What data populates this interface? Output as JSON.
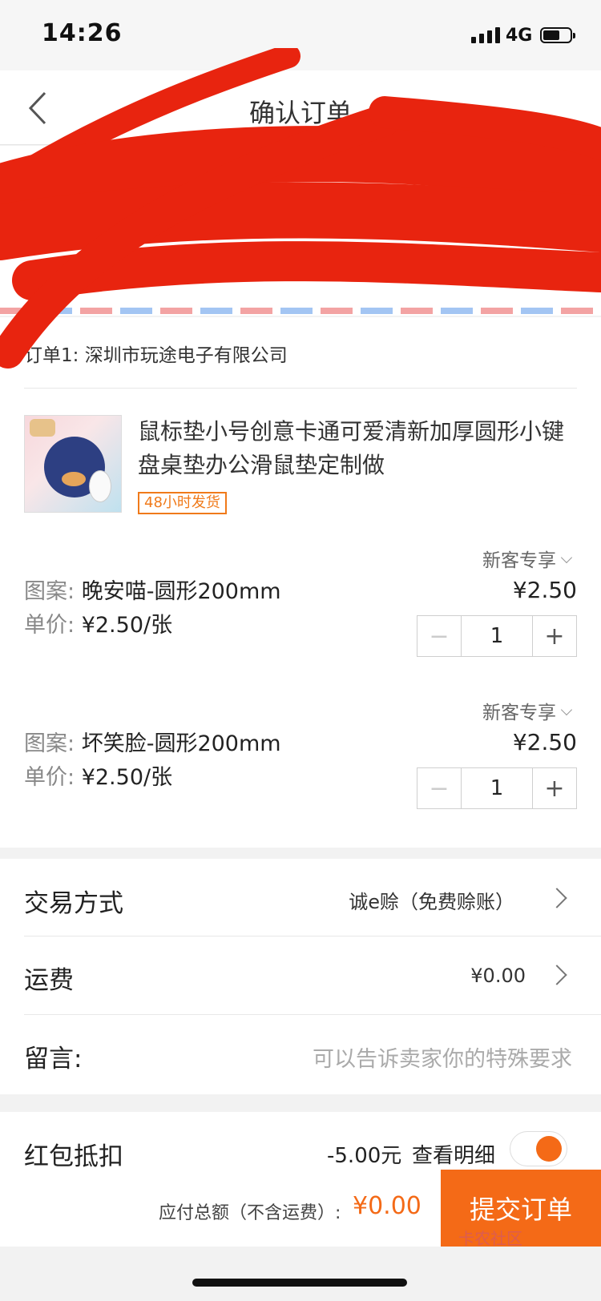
{
  "status_bar": {
    "time": "14:26",
    "network": "4G"
  },
  "nav": {
    "title": "确认订单"
  },
  "order": {
    "shop_label": "订单1: 深圳市玩途电子有限公司",
    "product": {
      "title": "鼠标垫小号创意卡通可爱清新加厚圆形小键盘桌垫办公滑鼠垫定制做",
      "tag": "48小时发货"
    },
    "items": [
      {
        "promo": "新客专享",
        "spec_key": "图案:",
        "spec_value": "晚安喵-圆形200mm",
        "unit_key": "单价:",
        "unit_value": "¥2.50/张",
        "price": "¥2.50",
        "qty": "1",
        "minus": "−",
        "plus": "+"
      },
      {
        "promo": "新客专享",
        "spec_key": "图案:",
        "spec_value": "坏笑脸-圆形200mm",
        "unit_key": "单价:",
        "unit_value": "¥2.50/张",
        "price": "¥2.50",
        "qty": "1",
        "minus": "−",
        "plus": "+"
      }
    ]
  },
  "rows": {
    "trade_label": "交易方式",
    "trade_value": "诚e赊（免费赊账）",
    "shipping_label": "运费",
    "shipping_value": "¥0.00",
    "message_label": "留言:",
    "message_placeholder": "可以告诉卖家你的特殊要求"
  },
  "bottom": {
    "redpacket_label": "红包抵扣",
    "redpacket_value": "-5.00元",
    "detail_link": "查看明细",
    "toggle_on": true,
    "total_label": "应付总额（不含运费）:",
    "total_amount": "¥0.00",
    "submit": "提交订单",
    "watermark": "卡农社区"
  },
  "colors": {
    "accent": "#f46a17",
    "scribble": "#e8240f"
  }
}
